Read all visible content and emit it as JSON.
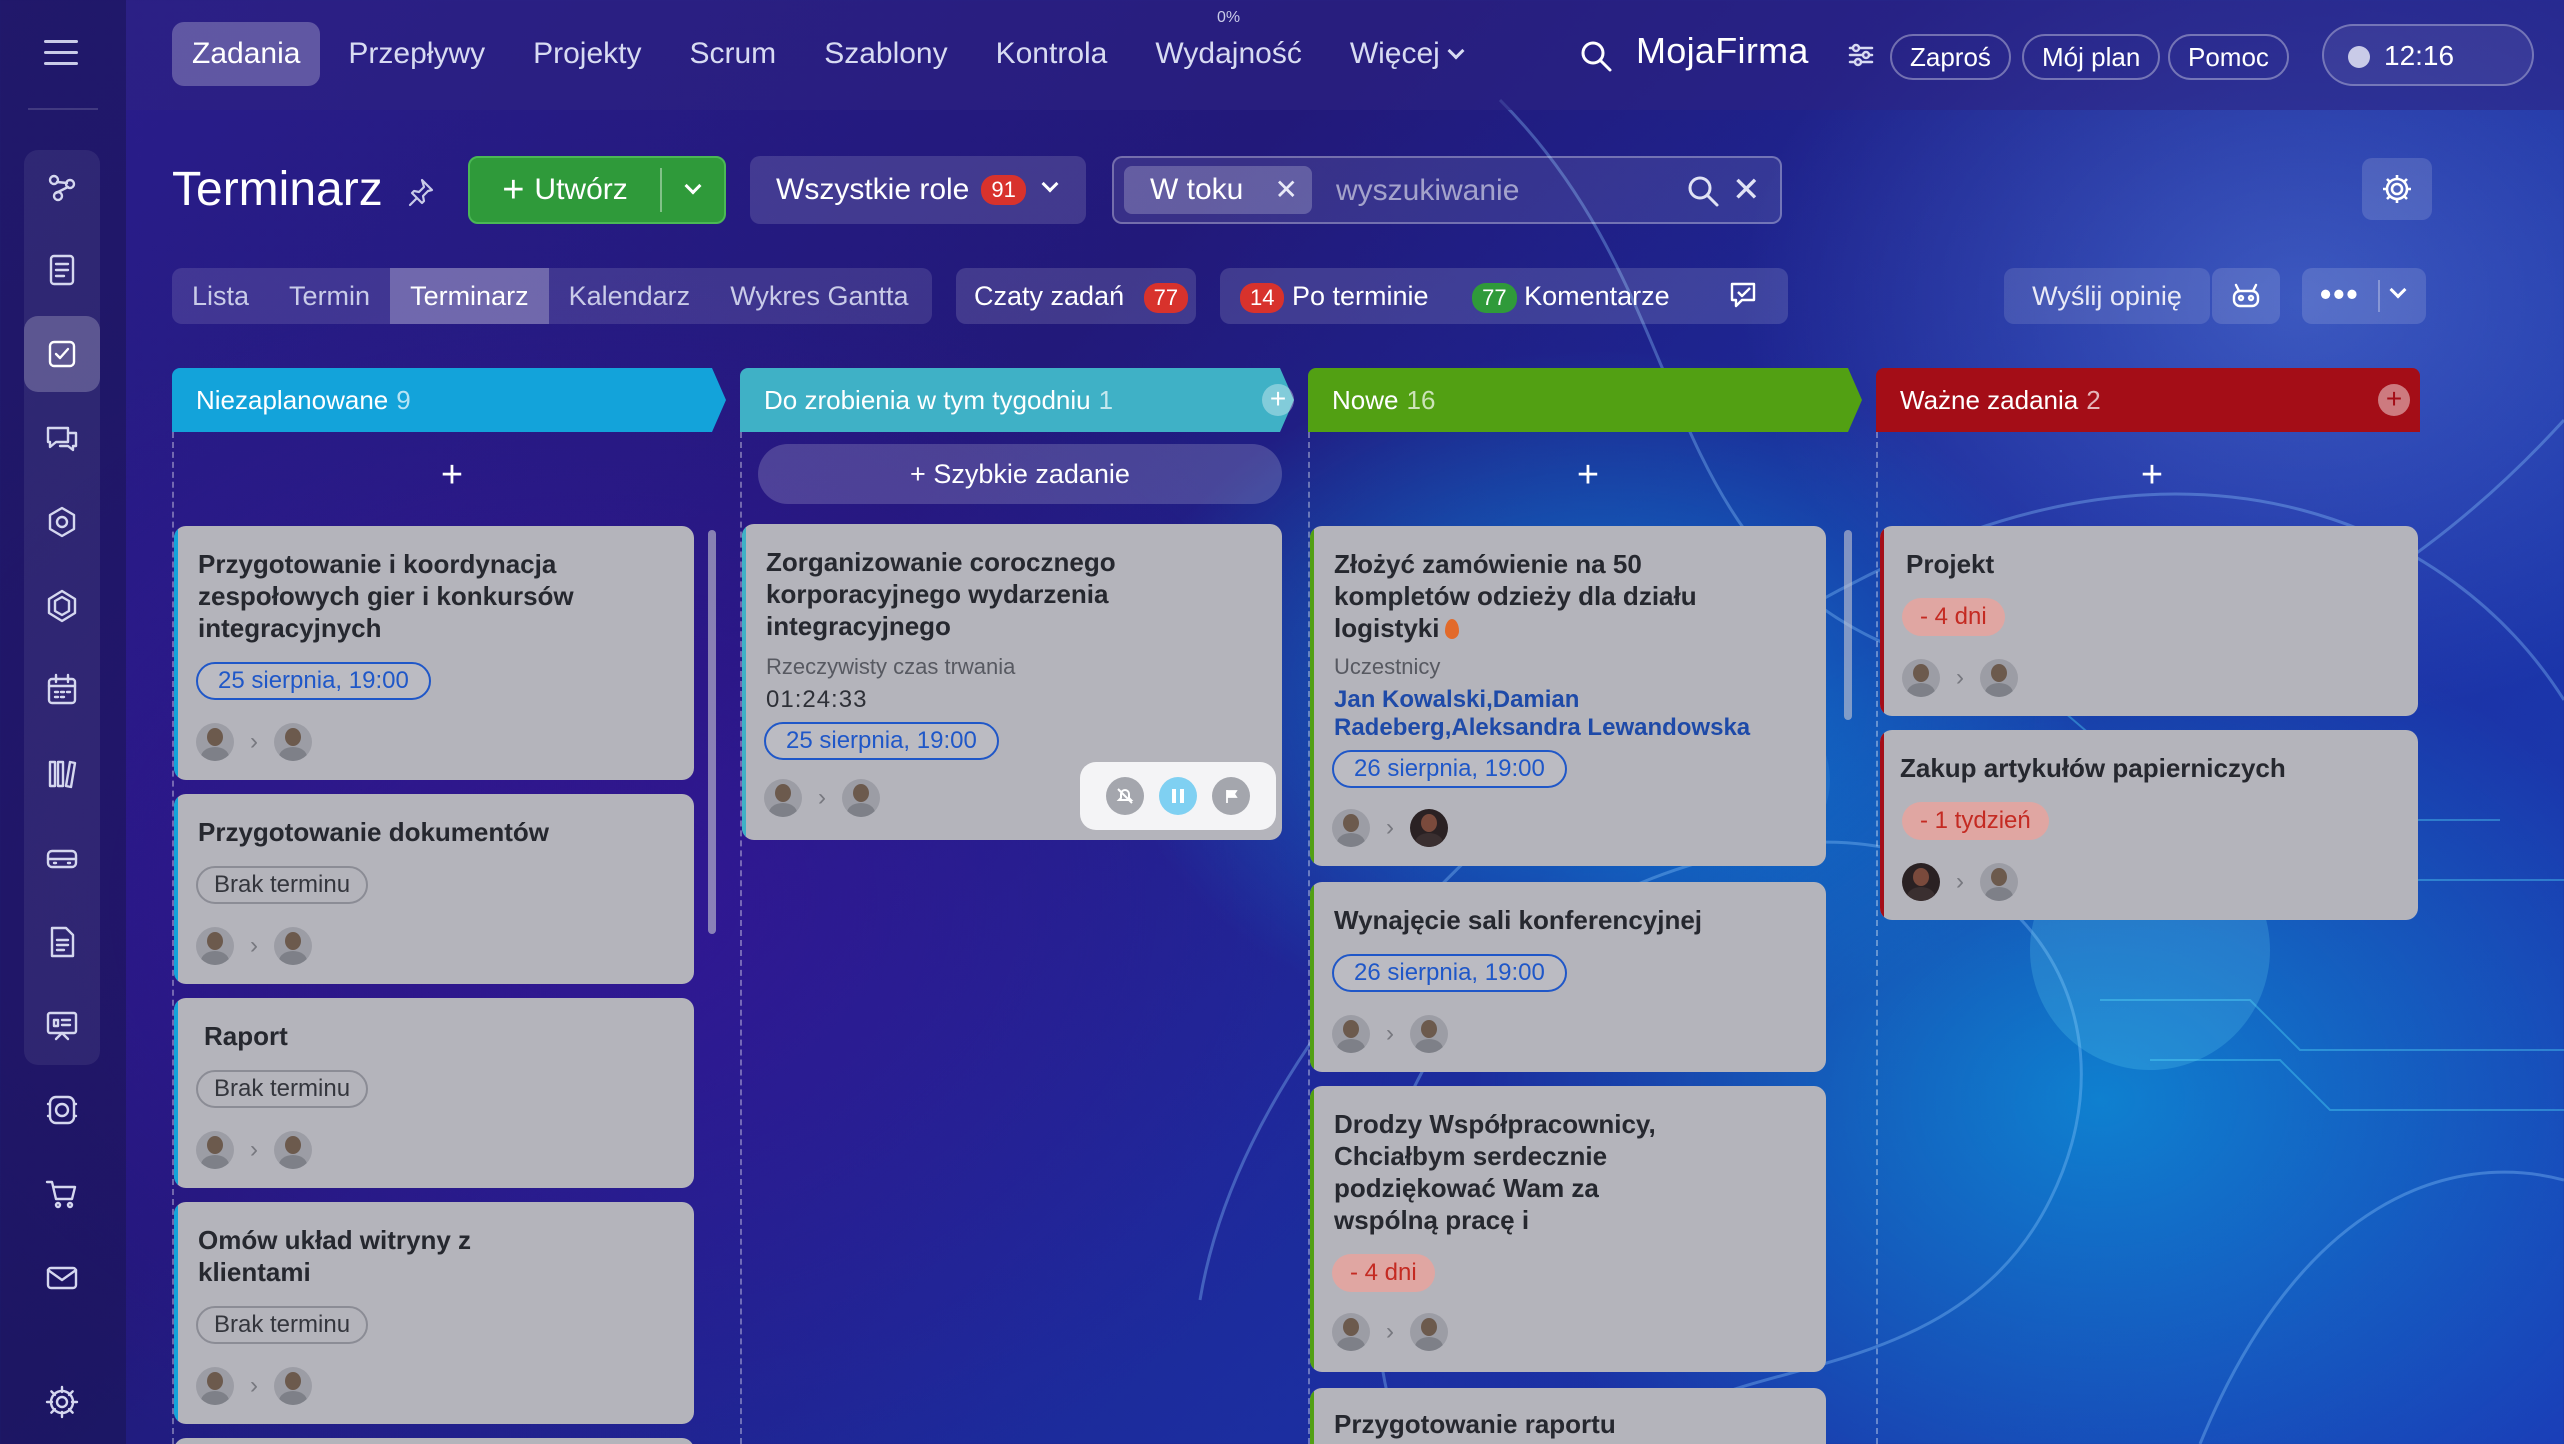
{
  "topnav": {
    "items": [
      "Zadania",
      "Przepływy",
      "Projekty",
      "Scrum",
      "Szablony",
      "Kontrola",
      "Wydajność",
      "Więcej"
    ],
    "efficiency_badge": "0%",
    "brand": "MojaFirma",
    "invite_label": "Zaproś",
    "plan_label": "Mój plan",
    "help_label": "Pomoc",
    "clock": "12:16"
  },
  "sidebar": {
    "icons": [
      "feed-icon",
      "document-icon",
      "tasks-icon",
      "chat-icon",
      "crm-icon",
      "marketing-icon",
      "calendar-icon",
      "library-icon",
      "inventory-icon",
      "invoice-icon",
      "presentation-icon",
      "automation-icon",
      "shop-icon",
      "mail-icon",
      "settings-icon"
    ]
  },
  "toolbar": {
    "title": "Terminarz",
    "create_label": "Utwórz",
    "roles_label": "Wszystkie role",
    "roles_count": "91",
    "filter_chip": "W toku",
    "search_placeholder": "wyszukiwanie"
  },
  "views": {
    "tabs": [
      "Lista",
      "Termin",
      "Terminarz",
      "Kalendarz",
      "Wykres Gantta"
    ],
    "active": "Terminarz",
    "chats_label": "Czaty zadań",
    "chats_count": "77",
    "overdue_count": "14",
    "overdue_label": "Po terminie",
    "comments_count": "77",
    "comments_label": "Komentarze",
    "feedback_label": "Wyślij opinię"
  },
  "colors": {
    "unplanned": "#13a3da",
    "this_week": "#3fb1c6",
    "new": "#52a013",
    "important": "#a40d17",
    "create": "#2f9a3a"
  },
  "columns": [
    {
      "title": "Niezaplanowane",
      "count": "9",
      "cards": [
        {
          "title": "Przygotowanie i koordynacja zespołowych gier i konkursów integracyjnych",
          "date": "25 sierpnia, 19:00"
        },
        {
          "title": "Przygotowanie dokumentów",
          "date": "Brak terminu"
        },
        {
          "title": "Raport",
          "date": "Brak terminu"
        },
        {
          "title": "Omów układ witryny z klientami",
          "date": "Brak terminu"
        }
      ]
    },
    {
      "title": "Do zrobienia w tym tygodniu",
      "count": "1",
      "quick_label": "Szybkie zadanie",
      "cards": [
        {
          "title": "Zorganizowanie corocznego korporacyjnego wydarzenia integracyjnego",
          "meta": "Rzeczywisty czas trwania",
          "timer": "01:24:33",
          "date": "25 sierpnia, 19:00"
        }
      ]
    },
    {
      "title": "Nowe",
      "count": "16",
      "cards": [
        {
          "title": "Złożyć zamówienie na 50 kompletów odzieży dla działu logistyki",
          "meta": "Uczestnicy",
          "people": "Jan Kowalski,Damian Radeberg,Aleksandra Lewandowska",
          "date": "26 sierpnia, 19:00"
        },
        {
          "title": "Wynajęcie sali konferencyjnej",
          "date": "26 sierpnia, 19:00"
        },
        {
          "title": "Drodzy Współpracownicy, Chciałbym serdecznie podziękować Wam za wspólną pracę i",
          "date": "- 4 dni"
        },
        {
          "title": "Przygotowanie raportu"
        }
      ]
    },
    {
      "title": "Ważne zadania",
      "count": "2",
      "cards": [
        {
          "title": "Projekt",
          "date": "- 4 dni"
        },
        {
          "title": "Zakup artykułów papierniczych",
          "date": "- 1 tydzień"
        }
      ]
    }
  ]
}
